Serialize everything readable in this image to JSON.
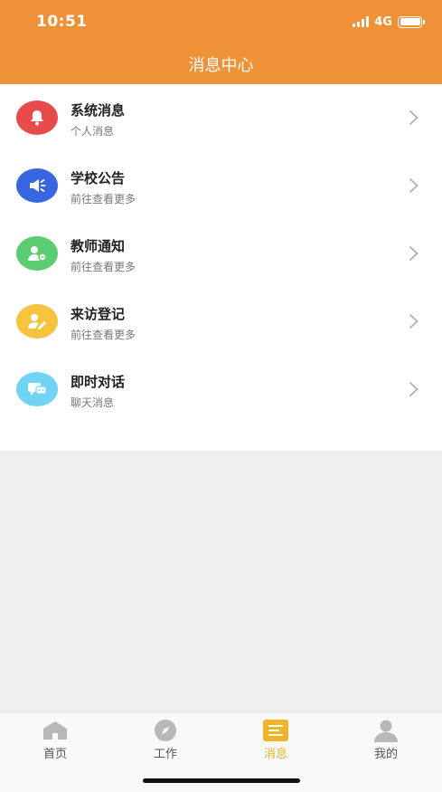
{
  "status_bar": {
    "time": "10:51",
    "network": "4G"
  },
  "header": {
    "title": "消息中心"
  },
  "items": [
    {
      "title": "系统消息",
      "subtitle": "个人消息",
      "icon": "bell-icon",
      "color": "#e84b4b"
    },
    {
      "title": "学校公告",
      "subtitle": "前往查看更多",
      "icon": "megaphone-icon",
      "color": "#3766e0"
    },
    {
      "title": "教师通知",
      "subtitle": "前往查看更多",
      "icon": "teacher-icon",
      "color": "#5bcc72"
    },
    {
      "title": "来访登记",
      "subtitle": "前往查看更多",
      "icon": "visitor-register-icon",
      "color": "#f6c33f"
    },
    {
      "title": "即时对话",
      "subtitle": "聊天消息",
      "icon": "chat-icon",
      "color": "#6fd3f3"
    }
  ],
  "tabbar": [
    {
      "label": "首页",
      "icon": "home-icon",
      "active": false
    },
    {
      "label": "工作",
      "icon": "compass-icon",
      "active": false
    },
    {
      "label": "消息",
      "icon": "message-list-icon",
      "active": true
    },
    {
      "label": "我的",
      "icon": "user-icon",
      "active": false
    }
  ],
  "colors": {
    "accent": "#ef9237",
    "tab_active": "#f0b42a"
  }
}
